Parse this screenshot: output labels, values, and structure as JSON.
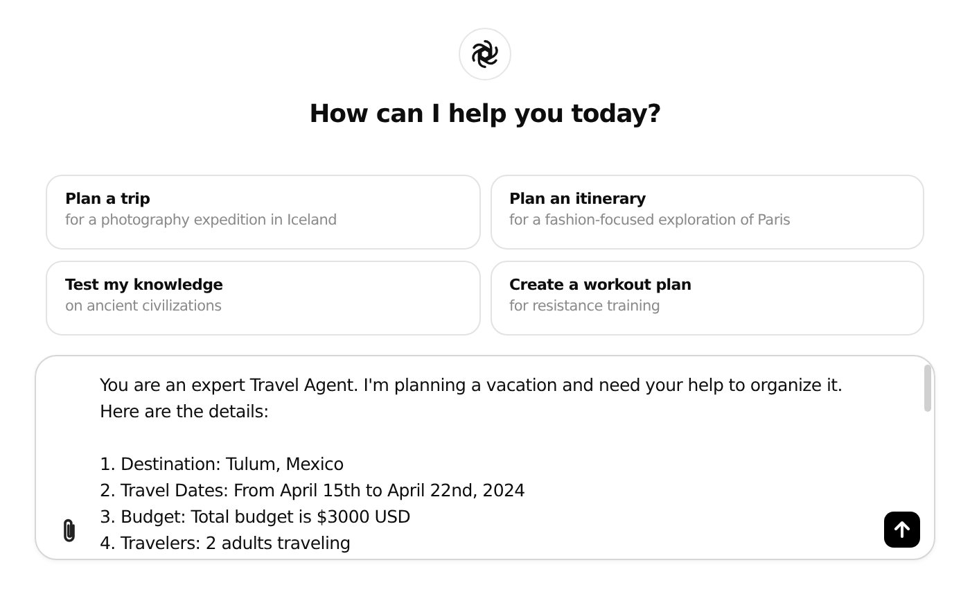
{
  "heading": "How can I help you today?",
  "suggestions": [
    {
      "title": "Plan a trip",
      "subtitle": "for a photography expedition in Iceland"
    },
    {
      "title": "Plan an itinerary",
      "subtitle": "for a fashion-focused exploration of Paris"
    },
    {
      "title": "Test my knowledge",
      "subtitle": "on ancient civilizations"
    },
    {
      "title": "Create a workout plan",
      "subtitle": "for resistance training"
    }
  ],
  "composer": {
    "paragraphs": [
      [
        "You are an expert Travel Agent. I'm planning a vacation and need your help to organize it.",
        "Here are the details:"
      ],
      [
        "1. Destination: Tulum, Mexico",
        "2. Travel Dates: From April 15th to April 22nd, 2024",
        "3. Budget: Total budget is $3000 USD",
        "4. Travelers: 2 adults traveling"
      ]
    ]
  }
}
